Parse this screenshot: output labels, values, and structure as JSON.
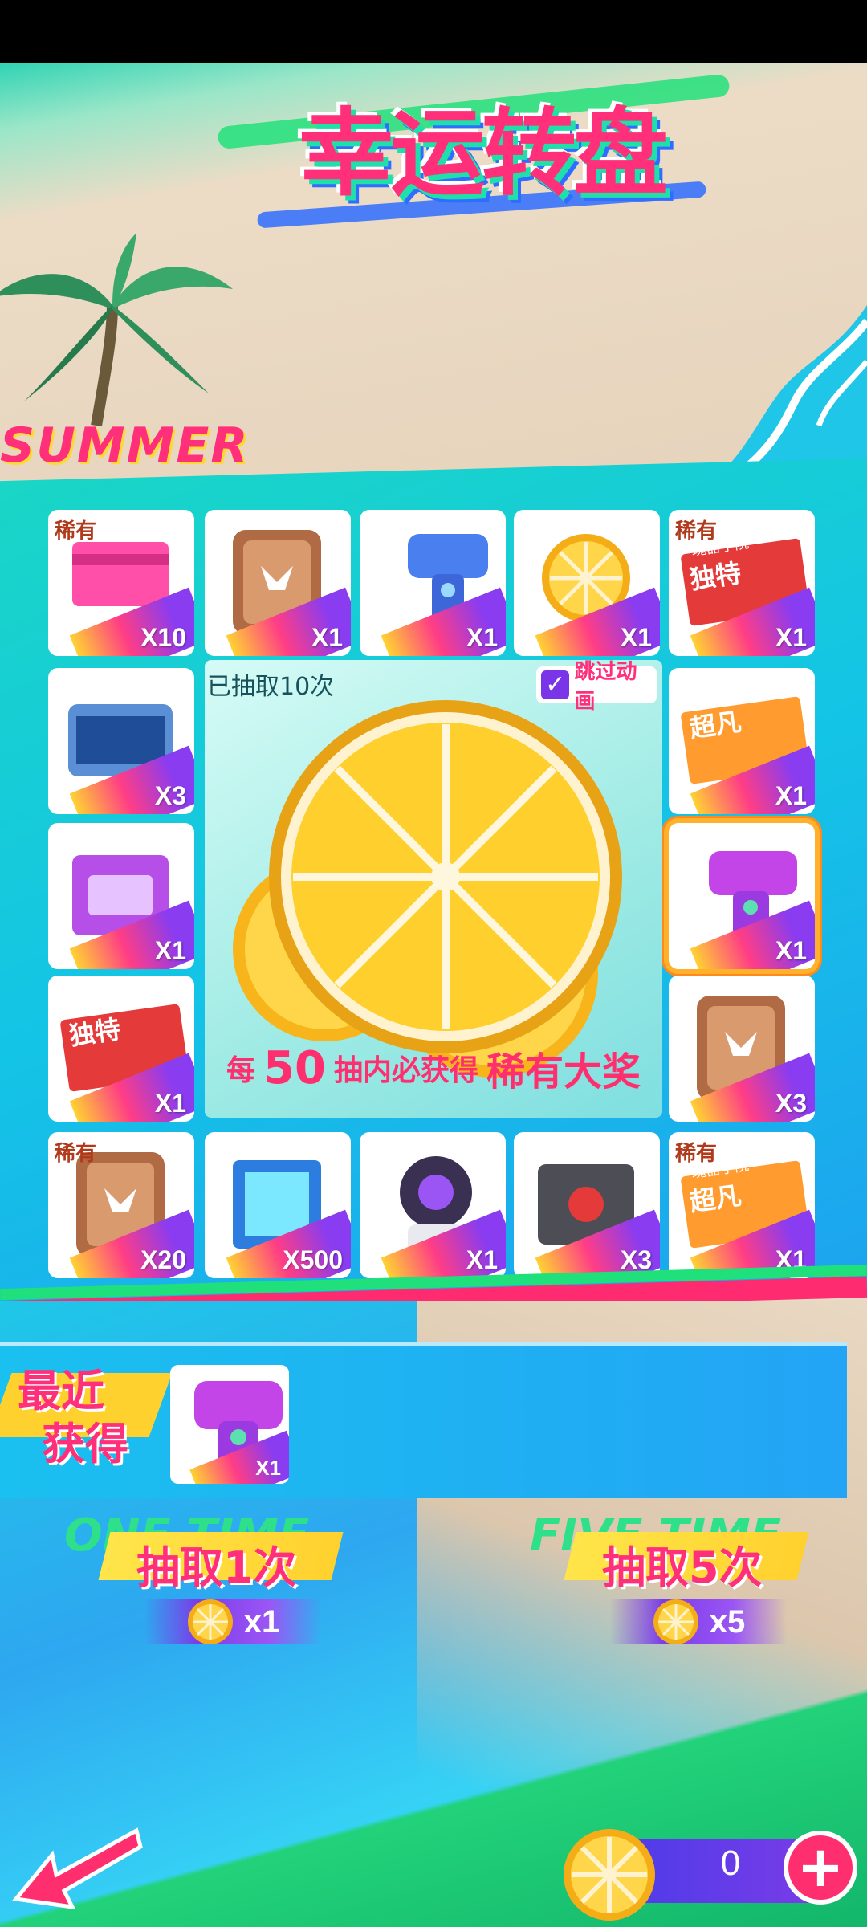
{
  "title": "幸运转盘",
  "banner_text": "SUMMER",
  "board": {
    "draw_count_text": "已抽取10次",
    "skip_animation_label": "跳过动画",
    "skip_animation_checked": true,
    "guarantee": {
      "prefix": "每",
      "number": "50",
      "middle": "抽内必获得",
      "reward": "稀有大奖"
    },
    "prize_items": [
      {
        "tag": "稀有",
        "qty": "X10",
        "icon": "pink-card-icon"
      },
      {
        "tag": "",
        "qty": "X1",
        "icon": "bronze-chip-icon"
      },
      {
        "tag": "",
        "qty": "X1",
        "icon": "blue-water-gun-icon"
      },
      {
        "tag": "",
        "qty": "X1",
        "icon": "lemon-slice-icon"
      },
      {
        "tag": "稀有",
        "qty": "X1",
        "icon": "red-ticket-icon",
        "ticket_label": "独特"
      },
      {
        "tag": "",
        "qty": "X3",
        "icon": "equipment-case-icon"
      },
      {
        "tag": "",
        "qty": "X1",
        "icon": "orange-ticket-icon",
        "ticket_label": "超凡"
      },
      {
        "tag": "",
        "qty": "X1",
        "icon": "purple-crate-icon"
      },
      {
        "tag": "",
        "qty": "X1",
        "icon": "purple-water-gun-icon",
        "selected": true
      },
      {
        "tag": "",
        "qty": "X1",
        "icon": "red-ticket-icon",
        "ticket_label": "独特"
      },
      {
        "tag": "",
        "qty": "X3",
        "icon": "bronze-chip-icon"
      },
      {
        "tag": "稀有",
        "qty": "X20",
        "icon": "bronze-chip-icon"
      },
      {
        "tag": "",
        "qty": "X500",
        "icon": "blue-cube-icon"
      },
      {
        "tag": "",
        "qty": "X1",
        "icon": "character-avatar-icon"
      },
      {
        "tag": "",
        "qty": "X3",
        "icon": "gray-box-icon"
      },
      {
        "tag": "稀有",
        "qty": "X1",
        "icon": "orange-ticket-icon",
        "ticket_label": "超凡"
      }
    ],
    "ticket_header": "瑰器学院"
  },
  "recent": {
    "title_line1": "最近",
    "title_line2": "获得",
    "items": [
      {
        "qty": "X1",
        "icon": "purple-water-gun-icon"
      }
    ]
  },
  "draw_buttons": [
    {
      "bg_text": "ONE TIME",
      "label": "抽取1次",
      "cost": "x1"
    },
    {
      "bg_text": "FIVE TIME",
      "label": "抽取5次",
      "cost": "x5"
    }
  ],
  "balance": {
    "value": "0"
  },
  "colors": {
    "accent_pink": "#ff2f7a",
    "accent_purple": "#7a3ce8",
    "accent_yellow": "#ffd233",
    "board_teal": "#19d6c6"
  }
}
